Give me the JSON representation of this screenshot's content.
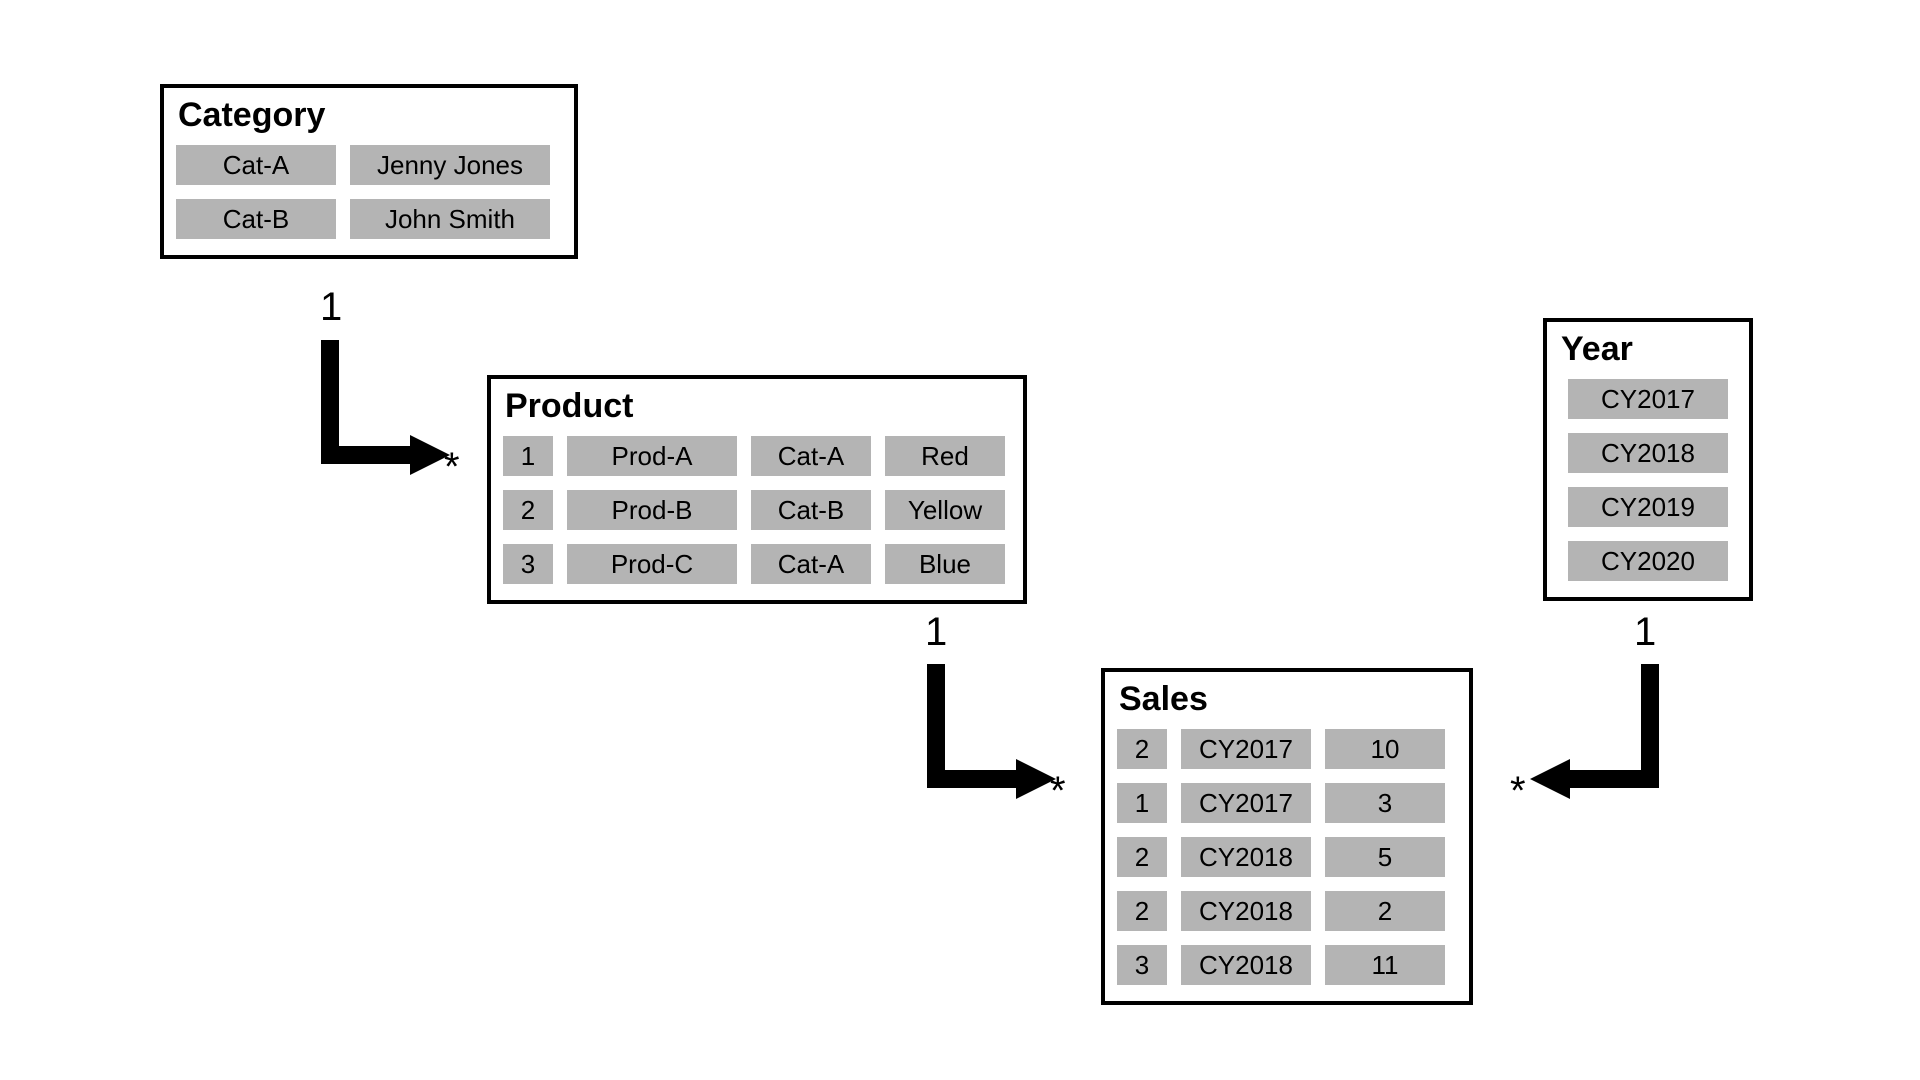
{
  "entities": {
    "category": {
      "title": "Category",
      "rows": [
        [
          "Cat-A",
          "Jenny Jones"
        ],
        [
          "Cat-B",
          "John Smith"
        ]
      ]
    },
    "product": {
      "title": "Product",
      "rows": [
        [
          "1",
          "Prod-A",
          "Cat-A",
          "Red"
        ],
        [
          "2",
          "Prod-B",
          "Cat-B",
          "Yellow"
        ],
        [
          "3",
          "Prod-C",
          "Cat-A",
          "Blue"
        ]
      ]
    },
    "year": {
      "title": "Year",
      "rows": [
        [
          "CY2017"
        ],
        [
          "CY2018"
        ],
        [
          "CY2019"
        ],
        [
          "CY2020"
        ]
      ]
    },
    "sales": {
      "title": "Sales",
      "rows": [
        [
          "2",
          "CY2017",
          "10"
        ],
        [
          "1",
          "CY2017",
          "3"
        ],
        [
          "2",
          "CY2018",
          "5"
        ],
        [
          "2",
          "CY2018",
          "2"
        ],
        [
          "3",
          "CY2018",
          "11"
        ]
      ]
    }
  },
  "cardinality": {
    "one": "1",
    "many": "*"
  }
}
